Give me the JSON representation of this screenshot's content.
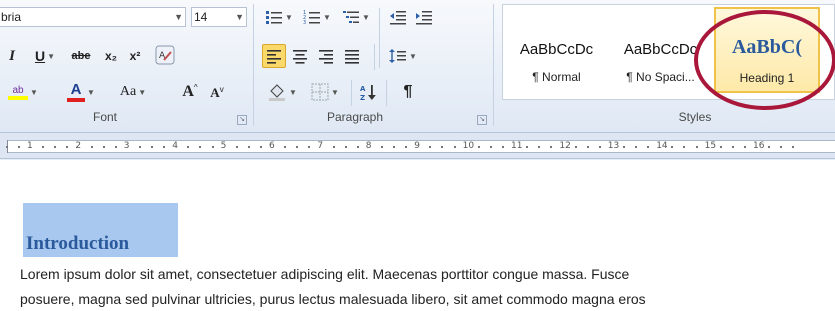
{
  "font": {
    "name_value": "bria",
    "size_value": "14",
    "italic": "I",
    "underline": "U",
    "strike": "abe",
    "subscript": "x₂",
    "superscript": "x²",
    "highlight": "ab",
    "font_color": "A",
    "change_case": "Aa",
    "grow": "A",
    "shrink": "A",
    "group_label": "Font"
  },
  "paragraph": {
    "pilcrow": "¶",
    "group_label": "Paragraph"
  },
  "styles": {
    "items": [
      {
        "sample": "AaBbCcDc",
        "name": "¶ Normal"
      },
      {
        "sample": "AaBbCcDc",
        "name": "¶ No Spaci..."
      },
      {
        "sample": "AaBbC(",
        "name": "Heading 1"
      }
    ],
    "group_label": "Styles"
  },
  "ruler": {
    "labels": [
      "1",
      "2",
      "3",
      "4",
      "5",
      "6",
      "7",
      "8",
      "9",
      "10",
      "11",
      "12",
      "13",
      "14",
      "15",
      "16"
    ]
  },
  "document": {
    "heading": "Introduction",
    "lines": [
      "Lorem ipsum dolor sit amet, consectetuer adipiscing elit.  Maecenas porttitor congue massa.  Fusce",
      "posuere, magna sed pulvinar ultricies, purus lectus malesuada libero, sit amet commodo magna eros"
    ]
  },
  "colors": {
    "heading_text": "#2a5a9c",
    "heading_highlight": "#a9c8ef",
    "selected_style_border": "#f0c24a",
    "annotation_circle": "#a9183a",
    "highlight_swatch": "#ffff00",
    "font_color_swatch": "#e02020"
  }
}
